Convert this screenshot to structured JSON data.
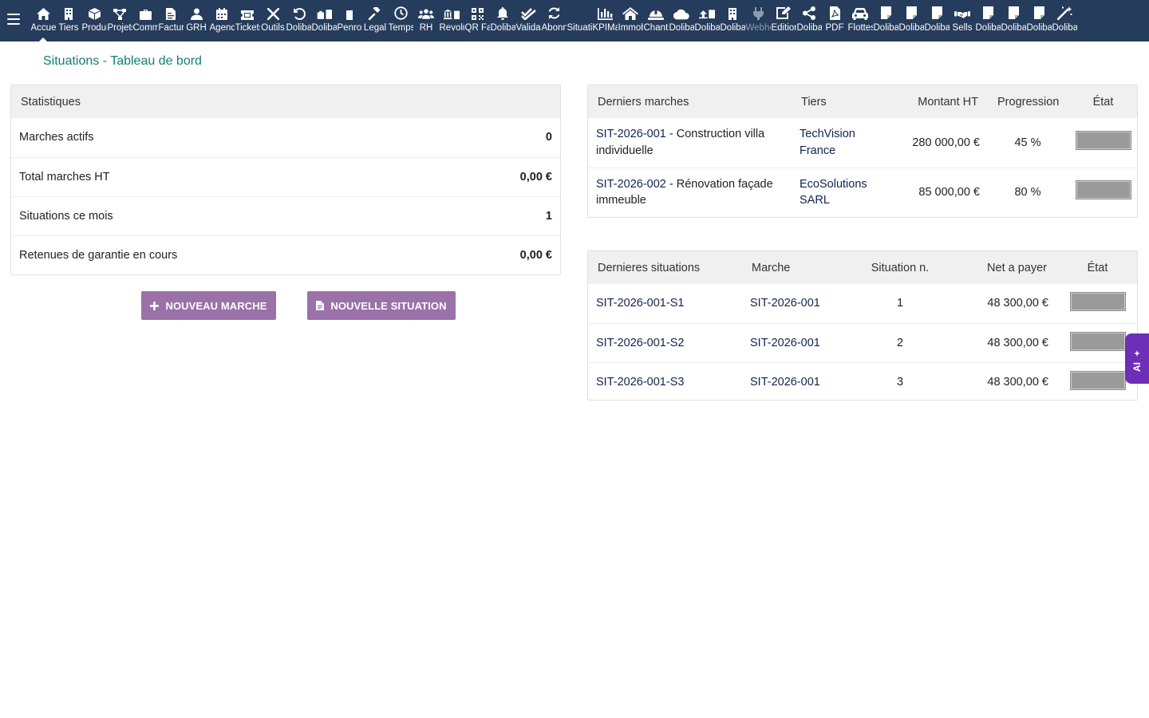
{
  "topbar": {
    "menu": [
      {
        "label": "Accueil",
        "icon": "home-icon",
        "active": true
      },
      {
        "label": "Tiers",
        "icon": "building-icon"
      },
      {
        "label": "Produits",
        "icon": "cube-icon"
      },
      {
        "label": "Projets",
        "icon": "project-icon"
      },
      {
        "label": "Commercial",
        "icon": "briefcase-icon"
      },
      {
        "label": "Facturation",
        "icon": "invoice-icon"
      },
      {
        "label": "GRH",
        "icon": "user-tie-icon"
      },
      {
        "label": "Agenda",
        "icon": "calendar-icon"
      },
      {
        "label": "Tickets",
        "icon": "ticket-icon"
      },
      {
        "label": "Outils",
        "icon": "tools-icon"
      },
      {
        "label": "Dolibarr",
        "icon": "undo-icon"
      },
      {
        "label": "Dolibarr",
        "icon": "suitcase-icon"
      },
      {
        "label": "Penrose",
        "icon": "note-icon"
      },
      {
        "label": "Legal",
        "icon": "gavel-icon"
      },
      {
        "label": "Temps",
        "icon": "clock-icon"
      },
      {
        "label": "RH",
        "icon": "users-icon"
      },
      {
        "label": "Revolut",
        "icon": "bank-icon"
      },
      {
        "label": "QR Facture",
        "icon": "qrcode-icon"
      },
      {
        "label": "Dolibarr",
        "icon": "bell-icon"
      },
      {
        "label": "Validation",
        "icon": "double-check-icon"
      },
      {
        "label": "Abonnements",
        "icon": "refresh-icon"
      },
      {
        "label": "Situations",
        "icon": "none"
      },
      {
        "label": "KPIMaster",
        "icon": "bar-chart-icon"
      },
      {
        "label": "Immobilier",
        "icon": "house-icon"
      },
      {
        "label": "Chantiers",
        "icon": "helmet-icon"
      },
      {
        "label": "Dolibarr",
        "icon": "cloud-icon"
      },
      {
        "label": "Dolibarr",
        "icon": "upload-icon"
      },
      {
        "label": "Dolibarr",
        "icon": "building-icon"
      },
      {
        "label": "Webhooks",
        "icon": "plug-icon",
        "dim": true
      },
      {
        "label": "Editions",
        "icon": "edit-icon"
      },
      {
        "label": "Dolibarr",
        "icon": "share-icon"
      },
      {
        "label": "PDF",
        "icon": "pdf-file-icon"
      },
      {
        "label": "Flottes",
        "icon": "car-icon"
      },
      {
        "label": "Dolibarr",
        "icon": "document-icon"
      },
      {
        "label": "Dolibarr",
        "icon": "document-icon"
      },
      {
        "label": "Dolibarr",
        "icon": "document-icon"
      },
      {
        "label": "Sells",
        "icon": "handshake-icon"
      },
      {
        "label": "Dolibarr",
        "icon": "document-icon"
      },
      {
        "label": "Dolibarr",
        "icon": "document-icon"
      },
      {
        "label": "Dolibarr",
        "icon": "document-icon"
      },
      {
        "label": "Dolibarr",
        "icon": "magic-wand-icon"
      }
    ]
  },
  "page": {
    "title": "Situations - Tableau de bord"
  },
  "stats": {
    "header": "Statistiques",
    "rows": [
      {
        "label": "Marches actifs",
        "value": "0"
      },
      {
        "label": "Total marches HT",
        "value": "0,00 €"
      },
      {
        "label": "Situations ce mois",
        "value": "1"
      },
      {
        "label": "Retenues de garantie en cours",
        "value": "0,00 €"
      }
    ]
  },
  "buttons": {
    "new_market": "NOUVEAU MARCHE",
    "new_situation": "NOUVELLE SITUATION"
  },
  "recent_markets": {
    "headers": {
      "market": "Derniers marches",
      "tiers": "Tiers",
      "amount": "Montant HT",
      "progress": "Progression",
      "state": "État"
    },
    "rows": [
      {
        "ref": "SIT-2026-001",
        "label": " - Construction villa individuelle",
        "tiers": "TechVision France",
        "amount": "280 000,00 €",
        "progress": "45 %"
      },
      {
        "ref": "SIT-2026-002",
        "label": " - Rénovation façade immeuble",
        "tiers": "EcoSolutions SARL",
        "amount": "85 000,00 €",
        "progress": "80 %"
      }
    ]
  },
  "recent_situations": {
    "headers": {
      "situation": "Dernieres situations",
      "market": "Marche",
      "number": "Situation n.",
      "net": "Net a payer",
      "state": "État"
    },
    "rows": [
      {
        "ref": "SIT-2026-001-S1",
        "market": "SIT-2026-001",
        "number": "1",
        "net": "48 300,00 €"
      },
      {
        "ref": "SIT-2026-001-S2",
        "market": "SIT-2026-001",
        "number": "2",
        "net": "48 300,00 €"
      },
      {
        "ref": "SIT-2026-001-S3",
        "market": "SIT-2026-001",
        "number": "3",
        "net": "48 300,00 €"
      }
    ]
  },
  "ai_tab": {
    "label": "AI"
  },
  "colors": {
    "topbar": "#263c5c",
    "accent_title": "#117f74",
    "button": "#9b71a9",
    "ai_tab": "#6d2eb8",
    "link": "#12234f"
  }
}
